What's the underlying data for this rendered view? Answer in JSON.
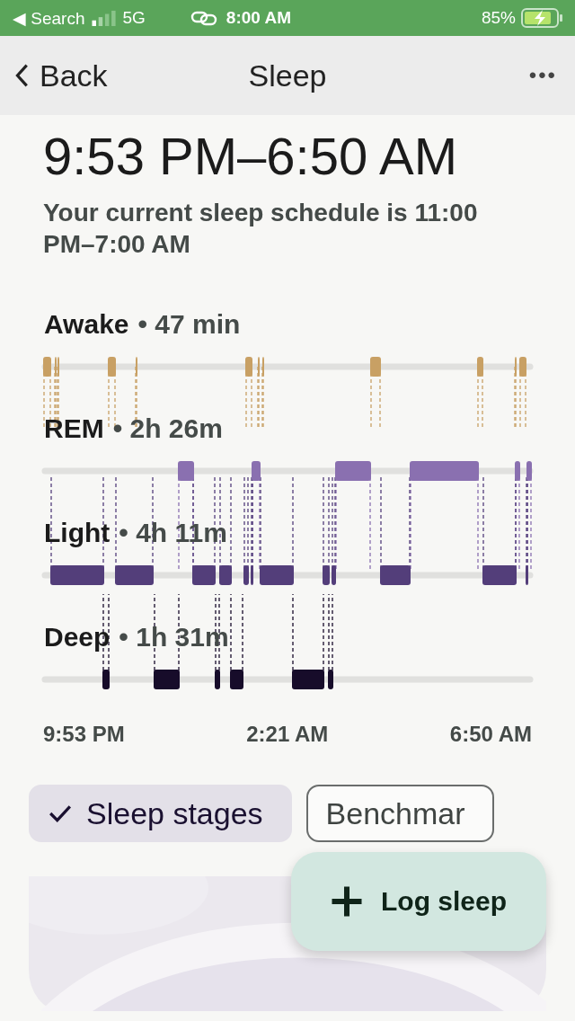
{
  "status_bar": {
    "back_label": "◀ Search",
    "network": "5G",
    "time": "8:00 AM",
    "battery": "85%"
  },
  "nav": {
    "back": "Back",
    "title": "Sleep",
    "more": "•••"
  },
  "sleep_range": "9:53 PM–6:50 AM",
  "schedule_note": "Your current sleep schedule is 11:00 PM–7:00 AM",
  "stages": [
    {
      "kind": "awake",
      "name": "Awake",
      "duration": "• 47 min",
      "color": "#c8a064"
    },
    {
      "kind": "rem",
      "name": "REM",
      "duration": "• 2h 26m",
      "color": "#8a70b0"
    },
    {
      "kind": "light",
      "name": "Light",
      "duration": "• 4h 11m",
      "color": "#533e7a"
    },
    {
      "kind": "deep",
      "name": "Deep",
      "duration": "• 1h 31m",
      "color": "#170c2a"
    }
  ],
  "time_axis": [
    "9:53 PM",
    "2:21 AM",
    "6:50 AM"
  ],
  "chips": [
    {
      "label": "Sleep stages",
      "selected": true
    },
    {
      "label": "Benchmar",
      "selected": false
    }
  ],
  "fab": {
    "label": "Log sleep"
  }
}
